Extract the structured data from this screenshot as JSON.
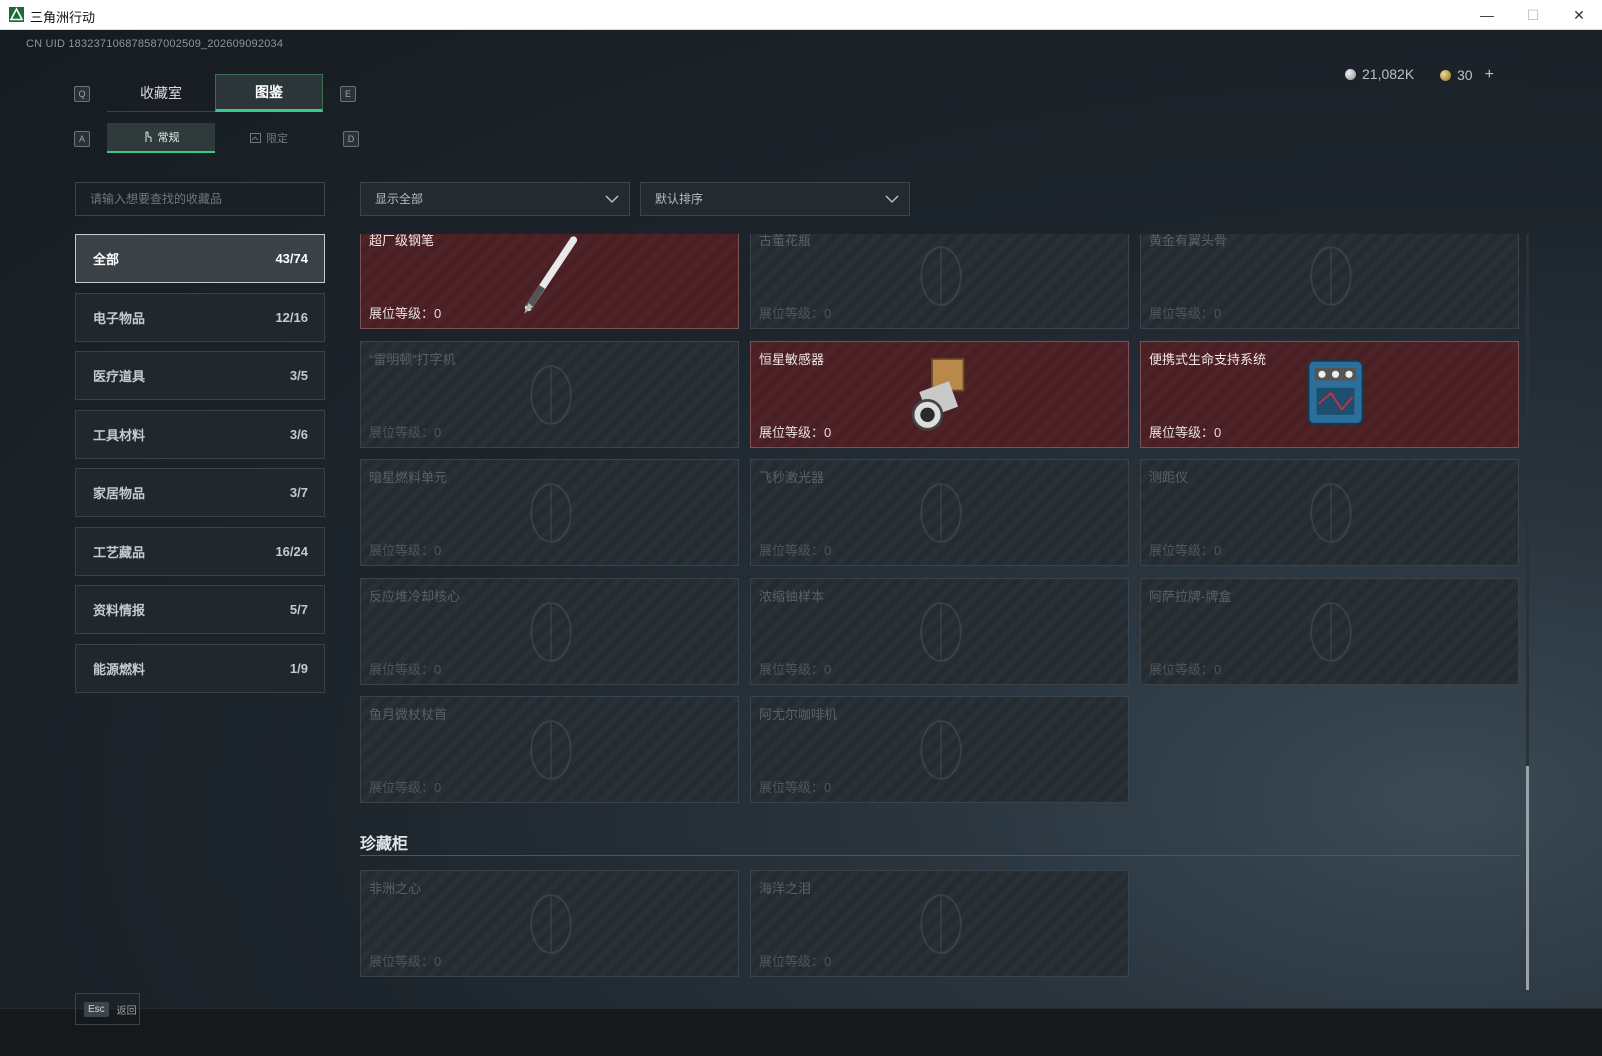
{
  "window": {
    "title": "三角洲行动",
    "minimize": "—",
    "maximize": "☐",
    "close": "✕"
  },
  "header": {
    "uid": "CN UID 183237106878587002509_202609092034",
    "currency_silver": "21,082K",
    "currency_gold": "30",
    "add_label": "+"
  },
  "key_hints": {
    "prev_tab": "Q",
    "next_tab": "E",
    "prev_sub": "A",
    "next_sub": "D"
  },
  "tabs": {
    "collection": "收藏室",
    "atlas": "图鉴"
  },
  "subtabs": {
    "regular": "常规",
    "limited": "限定"
  },
  "search": {
    "placeholder": "请输入想要查找的收藏品"
  },
  "filters": {
    "show": "显示全部",
    "sort": "默认排序"
  },
  "categories": [
    {
      "label": "全部",
      "count": "43/74"
    },
    {
      "label": "电子物品",
      "count": "12/16"
    },
    {
      "label": "医疗道具",
      "count": "3/5"
    },
    {
      "label": "工具材料",
      "count": "3/6"
    },
    {
      "label": "家居物品",
      "count": "3/7"
    },
    {
      "label": "工艺藏品",
      "count": "16/24"
    },
    {
      "label": "资料情报",
      "count": "5/7"
    },
    {
      "label": "能源燃料",
      "count": "1/9"
    }
  ],
  "items": [
    {
      "name": "超厂级钢笔",
      "level": "展位等级：0",
      "owned": true,
      "icon": "pen-icon"
    },
    {
      "name": "古董花瓶",
      "level": "展位等级：0",
      "owned": false,
      "icon": "vase-icon"
    },
    {
      "name": "黄金有翼头骨",
      "level": "展位等级：0",
      "owned": false,
      "icon": "skull-icon"
    },
    {
      "name": "“雷明顿”打字机",
      "level": "展位等级：0",
      "owned": false,
      "icon": "typewriter-icon"
    },
    {
      "name": "恒星敏感器",
      "level": "展位等级：0",
      "owned": true,
      "icon": "star-sensor-icon"
    },
    {
      "name": "便携式生命支持系统",
      "level": "展位等级：0",
      "owned": true,
      "icon": "life-support-icon"
    },
    {
      "name": "暗星燃料单元",
      "level": "展位等级：0",
      "owned": false,
      "icon": "fuel-cell-icon"
    },
    {
      "name": "飞秒激光器",
      "level": "展位等级：0",
      "owned": false,
      "icon": "laser-icon"
    },
    {
      "name": "测距仪",
      "level": "展位等级：0",
      "owned": false,
      "icon": "rangefinder-icon"
    },
    {
      "name": "反应堆冷却核心",
      "level": "展位等级：0",
      "owned": false,
      "icon": "reactor-core-icon"
    },
    {
      "name": "浓缩铀样本",
      "level": "展位等级：0",
      "owned": false,
      "icon": "uranium-icon"
    },
    {
      "name": "阿萨拉牌-牌盒",
      "level": "展位等级：0",
      "owned": false,
      "icon": "card-box-icon"
    },
    {
      "name": "鱼月微杖杖首",
      "level": "展位等级：0",
      "owned": false,
      "icon": "scepter-icon"
    },
    {
      "name": "阿尤尔咖啡机",
      "level": "展位等级：0",
      "owned": false,
      "icon": "coffee-machine-icon"
    }
  ],
  "cabinet": {
    "title": "珍藏柜",
    "items": [
      {
        "name": "非洲之心",
        "level": "展位等级：0",
        "owned": false,
        "icon": "gem-icon"
      },
      {
        "name": "海洋之泪",
        "level": "展位等级：0",
        "owned": false,
        "icon": "pearl-icon"
      }
    ]
  },
  "footer": {
    "esc_key": "Esc",
    "back_label": "返回"
  }
}
